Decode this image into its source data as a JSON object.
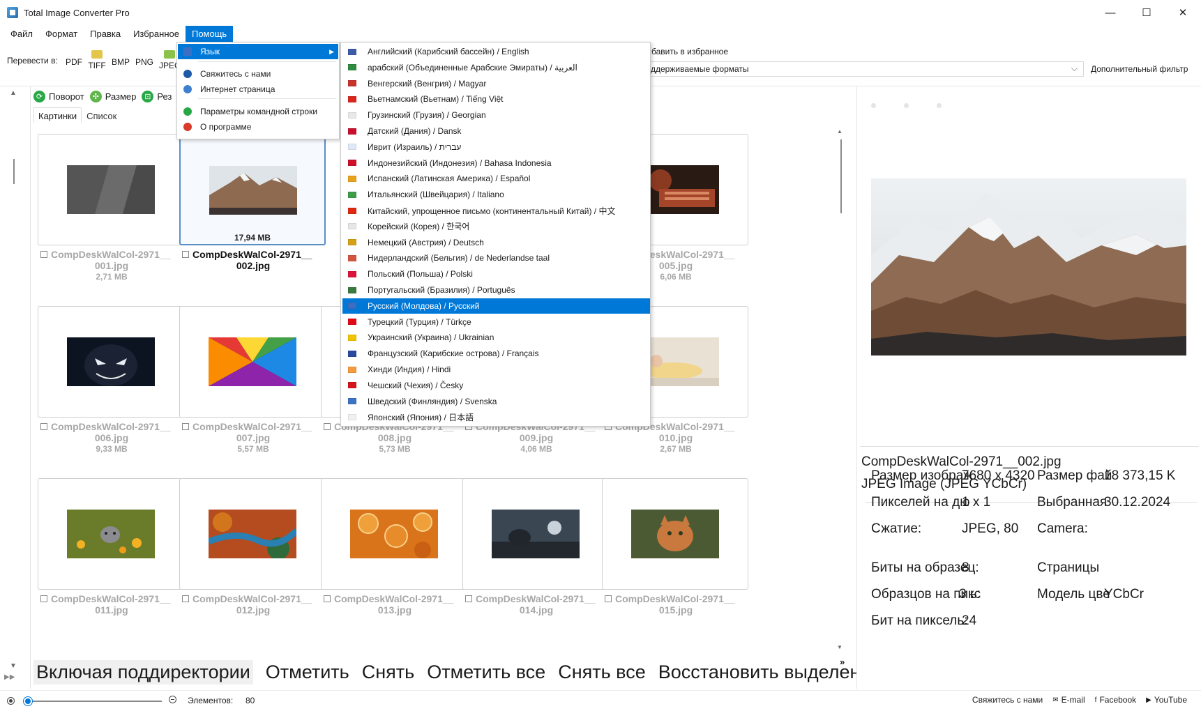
{
  "window": {
    "title": "Total Image Converter Pro",
    "controls": {
      "minimize": "—",
      "maximize": "☐",
      "close": "✕"
    }
  },
  "menubar": {
    "items": [
      "Файл",
      "Формат",
      "Правка",
      "Избранное",
      "Помощь"
    ],
    "active_index": 4
  },
  "toolbar": {
    "convert_label": "Перевести в:",
    "formats": [
      "PDF",
      "TIFF",
      "BMP",
      "PNG",
      "JPEG"
    ],
    "favorites_partial": "бавить в избранное",
    "formats_combo_value": "ддерживаемые форматы",
    "extra_filter": "Дополнительный фильтр"
  },
  "toolbar2": {
    "rotate": "Поворот",
    "resize": "Размер",
    "crop_partial": "Рез"
  },
  "tabs": [
    "Картинки",
    "Список"
  ],
  "help_menu": {
    "items": [
      {
        "label": "Язык",
        "icon": "flag-icon",
        "submenu": true,
        "active": true
      },
      {
        "label": "Свяжитесь с нами",
        "icon": "contact-icon"
      },
      {
        "label": "Интернет страница",
        "icon": "globe-icon"
      },
      {
        "label": "Параметры командной строки",
        "icon": "terminal-icon"
      },
      {
        "label": "О программе",
        "icon": "info-icon"
      }
    ]
  },
  "language_menu": {
    "selected_index": 16,
    "items": [
      {
        "label": "Английский (Карибский бассейн) / English",
        "flag": "#3c5ba8"
      },
      {
        "label": "арабский (Объединенные Арабские Эмираты) / العربية",
        "flag": "#2e8b3f"
      },
      {
        "label": "Венгерский (Венгрия) / Magyar",
        "flag": "#c8342c"
      },
      {
        "label": "Вьетнамский (Вьетнам) / Tiếng Việt",
        "flag": "#da251d"
      },
      {
        "label": "Грузинский (Грузия) / Georgian",
        "flag": "#e8e8e8"
      },
      {
        "label": "Датский (Дания) / Dansk",
        "flag": "#c8102e"
      },
      {
        "label": "Иврит (Израиль) / עברית",
        "flag": "#dfe8f6"
      },
      {
        "label": "Индонезийский (Индонезия) / Bahasa Indonesia",
        "flag": "#ce1126"
      },
      {
        "label": "Испанский (Латинская Америка) / Español",
        "flag": "#e8a21c"
      },
      {
        "label": "Итальянский (Швейцария) / Italiano",
        "flag": "#3f9c48"
      },
      {
        "label": "Китайский, упрощенное письмо (континентальный Китай) / 中文",
        "flag": "#de2910"
      },
      {
        "label": "Корейский (Корея) / 한국어",
        "flag": "#e6e6e6"
      },
      {
        "label": "Немецкий (Австрия) / Deutsch",
        "flag": "#d4a017"
      },
      {
        "label": "Нидерландский (Бельгия) / de Nederlandse taal",
        "flag": "#d4553f"
      },
      {
        "label": "Польский (Польша) / Polski",
        "flag": "#dc143c"
      },
      {
        "label": "Португальский (Бразилия) / Português",
        "flag": "#3b7a3f"
      },
      {
        "label": "Русский (Молдова) / Русский",
        "flag": "#3b6fc4"
      },
      {
        "label": "Турецкий (Турция) / Türkçe",
        "flag": "#e30a17"
      },
      {
        "label": "Украинский (Украина) / Ukrainian",
        "flag": "#f2c400"
      },
      {
        "label": "Французский (Карибские острова) / Français",
        "flag": "#2a4aa0"
      },
      {
        "label": "Хинди (Индия) / Hindi",
        "flag": "#f59a3d"
      },
      {
        "label": "Чешский (Чехия) / Česky",
        "flag": "#d7141a"
      },
      {
        "label": "Шведский (Финляндия) / Svenska",
        "flag": "#3c73c4"
      },
      {
        "label": "Японский (Япония) / 日本語",
        "flag": "#f0f0f0"
      }
    ]
  },
  "thumbnails": [
    {
      "name": "CompDeskWalCol-2971__",
      "ext": "001.jpg",
      "size": "2,71 MB",
      "image": "dark-abstract"
    },
    {
      "name": "CompDeskWalCol-2971__",
      "ext": "002.jpg",
      "size": "17,94 MB",
      "image": "mountain",
      "selected": true
    },
    {
      "name": "CompDeskWalCol-2971__",
      "ext": "005.jpg",
      "size": "6,06 MB",
      "image": "titan"
    },
    {
      "name": "CompDeskWalCol-2971__",
      "ext": "006.jpg",
      "size": "9,33 MB",
      "image": "venom"
    },
    {
      "name": "CompDeskWalCol-2971__",
      "ext": "007.jpg",
      "size": "5,57 MB",
      "image": "umbrella"
    },
    {
      "name": "CompDeskWalCol-2971__",
      "ext": "008.jpg",
      "size": "5,73 MB",
      "image": "hidden"
    },
    {
      "name": "CompDeskWalCol-2971__",
      "ext": "009.jpg",
      "size": "4,06 MB",
      "image": "hidden"
    },
    {
      "name": "CompDeskWalCol-2971__",
      "ext": "010.jpg",
      "size": "2,67 MB",
      "image": "girl"
    },
    {
      "name": "CompDeskWalCol-2971__",
      "ext": "011.jpg",
      "image": "cat-flowers"
    },
    {
      "name": "CompDeskWalCol-2971__",
      "ext": "012.jpg",
      "image": "river-aerial"
    },
    {
      "name": "CompDeskWalCol-2971__",
      "ext": "013.jpg",
      "image": "orange-slices"
    },
    {
      "name": "CompDeskWalCol-2971__",
      "ext": "014.jpg",
      "image": "lion-moon"
    },
    {
      "name": "CompDeskWalCol-2971__",
      "ext": "015.jpg",
      "image": "ginger-cat"
    }
  ],
  "actions": [
    "Включая поддиректории",
    "Отметить",
    "Снять",
    "Отметить все",
    "Снять все",
    "Восстановить выделение"
  ],
  "actions_more": "»",
  "details": {
    "filename": "CompDeskWalCol-2971__002.jpg",
    "type": "JPEG Image (JPEG YCbCr)",
    "rows": [
      {
        "label": "Размер изображ",
        "value": "7680 x 4320",
        "label2": "Размер фай",
        "value2": "18 373,15 K"
      },
      {
        "label": "Пикселей на дю",
        "value": "1 x 1",
        "label2": "Выбранная",
        "value2": "30.12.2024"
      },
      {
        "label": "Сжатие:",
        "value": "JPEG, 80",
        "label2": "Camera:",
        "value2": ""
      },
      {
        "label": "Биты на образец:",
        "value": "8",
        "label2": "Страницы",
        "value2": ""
      },
      {
        "label": "Образцов на пикс",
        "value": "3 ь:",
        "label2": "Модель цве",
        "value2": "YCbCr"
      },
      {
        "label": "Бит на пиксель:",
        "value": "24",
        "label2": "",
        "value2": ""
      }
    ]
  },
  "statusbar": {
    "count_label": "Элементов:",
    "count": "80",
    "links": [
      {
        "label": "Свяжитесь с нами",
        "icon": ""
      },
      {
        "label": "E-mail",
        "icon": "✉"
      },
      {
        "label": "Facebook",
        "icon": "f"
      },
      {
        "label": "YouTube",
        "icon": "▶"
      }
    ]
  },
  "colors": {
    "accent": "#0078d7",
    "selected_border": "#5a8fc4",
    "muted_text": "#a7a7a7"
  }
}
